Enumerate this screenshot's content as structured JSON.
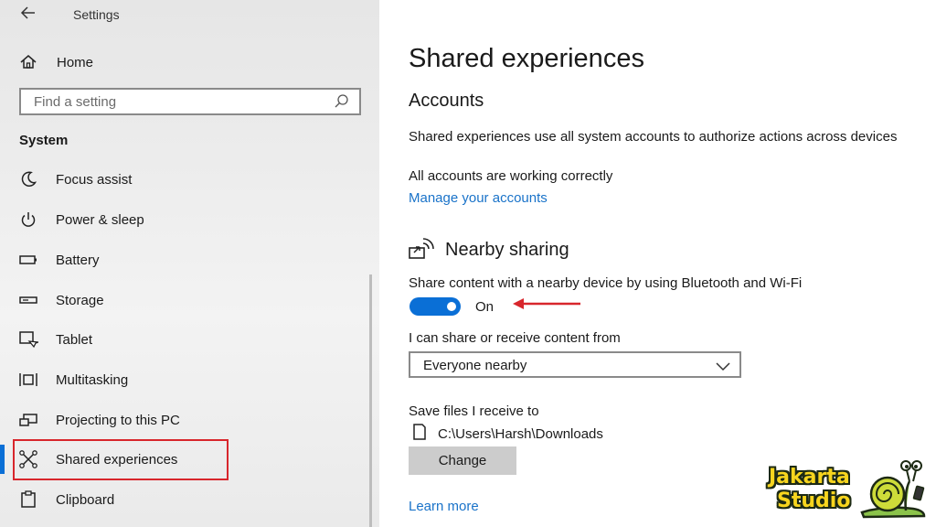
{
  "window": {
    "title": "Settings",
    "back_icon": "back-arrow-icon"
  },
  "sidebar": {
    "home_label": "Home",
    "search_placeholder": "Find a setting",
    "section_label": "System",
    "items": [
      {
        "label": "Focus assist",
        "icon": "moon-icon"
      },
      {
        "label": "Power & sleep",
        "icon": "power-icon"
      },
      {
        "label": "Battery",
        "icon": "battery-icon"
      },
      {
        "label": "Storage",
        "icon": "storage-icon"
      },
      {
        "label": "Tablet",
        "icon": "tablet-icon"
      },
      {
        "label": "Multitasking",
        "icon": "multitasking-icon"
      },
      {
        "label": "Projecting to this PC",
        "icon": "projecting-icon"
      },
      {
        "label": "Shared experiences",
        "icon": "shared-experiences-icon",
        "selected": true
      },
      {
        "label": "Clipboard",
        "icon": "clipboard-icon"
      }
    ]
  },
  "main": {
    "title": "Shared experiences",
    "accounts": {
      "heading": "Accounts",
      "description": "Shared experiences use all system accounts to authorize actions across devices",
      "status": "All accounts are working correctly",
      "manage_link": "Manage your accounts"
    },
    "nearby": {
      "heading": "Nearby sharing",
      "description": "Share content with a nearby device by using Bluetooth and Wi-Fi",
      "toggle_state": "On",
      "toggle_on": true,
      "share_from_label": "I can share or receive content from",
      "share_from_value": "Everyone nearby",
      "save_label": "Save files I receive to",
      "save_path": "C:\\Users\\Harsh\\Downloads",
      "change_button": "Change"
    },
    "learn_more": "Learn more"
  },
  "watermark": {
    "line1": "Jakarta",
    "line2": "Studio"
  },
  "colors": {
    "accent": "#0a6fd6",
    "link": "#1a73c9",
    "highlight_red": "#d8262c",
    "logo_yellow": "#f7d51e"
  }
}
